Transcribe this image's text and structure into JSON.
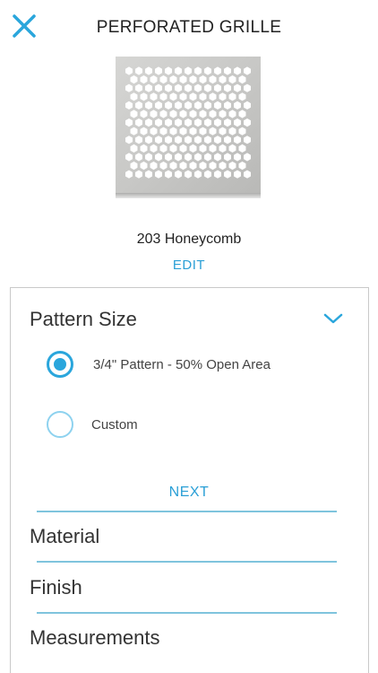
{
  "header": {
    "title": "PERFORATED GRILLE",
    "close_icon": "close-icon"
  },
  "product": {
    "name": "203 Honeycomb",
    "edit_label": "EDIT",
    "image": "honeycomb-grille-image"
  },
  "colors": {
    "accent": "#2aa6dc",
    "divider": "#7fc4dd",
    "card_border": "#c9c9c9"
  },
  "pattern_size": {
    "title": "Pattern Size",
    "expanded": true,
    "options": [
      {
        "label": "3/4\" Pattern - 50% Open Area",
        "selected": true
      },
      {
        "label": "Custom",
        "selected": false
      }
    ],
    "next_label": "NEXT"
  },
  "sections": [
    {
      "label": "Material"
    },
    {
      "label": "Finish"
    },
    {
      "label": "Measurements"
    }
  ]
}
